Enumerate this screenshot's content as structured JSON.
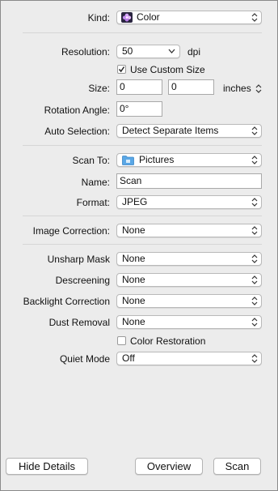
{
  "kind": {
    "label": "Kind:",
    "value": "Color",
    "icon": "color-flower-icon"
  },
  "resolution": {
    "label": "Resolution:",
    "value": "50",
    "unit": "dpi"
  },
  "use_custom_size": {
    "label": "Use Custom Size",
    "checked": true
  },
  "size": {
    "label": "Size:",
    "width": "0",
    "height": "0",
    "unit": "inches"
  },
  "rotation_angle": {
    "label": "Rotation Angle:",
    "value": "0°"
  },
  "auto_selection": {
    "label": "Auto Selection:",
    "value": "Detect Separate Items"
  },
  "scan_to": {
    "label": "Scan To:",
    "value": "Pictures",
    "icon": "folder-icon"
  },
  "name": {
    "label": "Name:",
    "value": "Scan"
  },
  "format": {
    "label": "Format:",
    "value": "JPEG"
  },
  "image_correction": {
    "label": "Image Correction:",
    "value": "None"
  },
  "unsharp_mask": {
    "label": "Unsharp Mask",
    "value": "None"
  },
  "descreening": {
    "label": "Descreening",
    "value": "None"
  },
  "backlight_correction": {
    "label": "Backlight Correction",
    "value": "None"
  },
  "dust_removal": {
    "label": "Dust Removal",
    "value": "None"
  },
  "color_restoration": {
    "label": "Color Restoration",
    "checked": false
  },
  "quiet_mode": {
    "label": "Quiet Mode",
    "value": "Off"
  },
  "buttons": {
    "hide_details": "Hide Details",
    "overview": "Overview",
    "scan": "Scan"
  },
  "colors": {
    "background": "#ececec",
    "separator": "#d6d6d6",
    "folder": "#5aa7e6"
  }
}
